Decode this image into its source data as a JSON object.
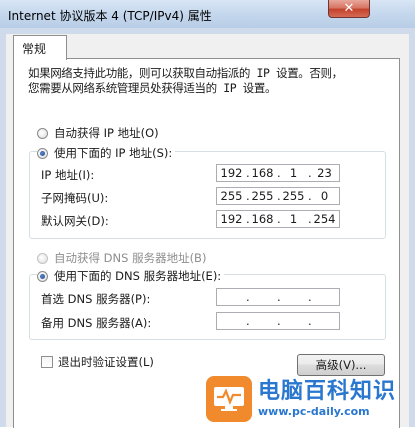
{
  "window": {
    "title": "Internet 协议版本 4 (TCP/IPv4) 属性",
    "close_symbol": "✕"
  },
  "tabs": [
    {
      "label": "常规"
    }
  ],
  "description": "如果网络支持此功能，则可以获取自动指派的 IP 设置。否则，\n您需要从网络系统管理员处获得适当的 IP 设置。",
  "ip_section": {
    "auto_label": "自动获得 IP 地址(O)",
    "manual_label": "使用下面的 IP 地址(S):",
    "selected": "manual",
    "fields": [
      {
        "label": "IP 地址(I):",
        "octets": [
          "192",
          "168",
          "1",
          "23"
        ]
      },
      {
        "label": "子网掩码(U):",
        "octets": [
          "255",
          "255",
          "255",
          "0"
        ]
      },
      {
        "label": "默认网关(D):",
        "octets": [
          "192",
          "168",
          "1",
          "254"
        ]
      }
    ]
  },
  "dns_section": {
    "auto_label": "自动获得 DNS 服务器地址(B)",
    "manual_label": "使用下面的 DNS 服务器地址(E):",
    "selected": "manual",
    "fields": [
      {
        "label": "首选 DNS 服务器(P):",
        "octets": [
          "",
          "",
          "",
          ""
        ]
      },
      {
        "label": "备用 DNS 服务器(A):",
        "octets": [
          "",
          "",
          "",
          ""
        ]
      }
    ]
  },
  "validate_on_exit": {
    "label": "退出时验证设置(L)",
    "checked": false
  },
  "advanced_button": "高级(V)...",
  "watermark": {
    "title": "电脑百科知识",
    "url": "www.pc-daily.com"
  }
}
